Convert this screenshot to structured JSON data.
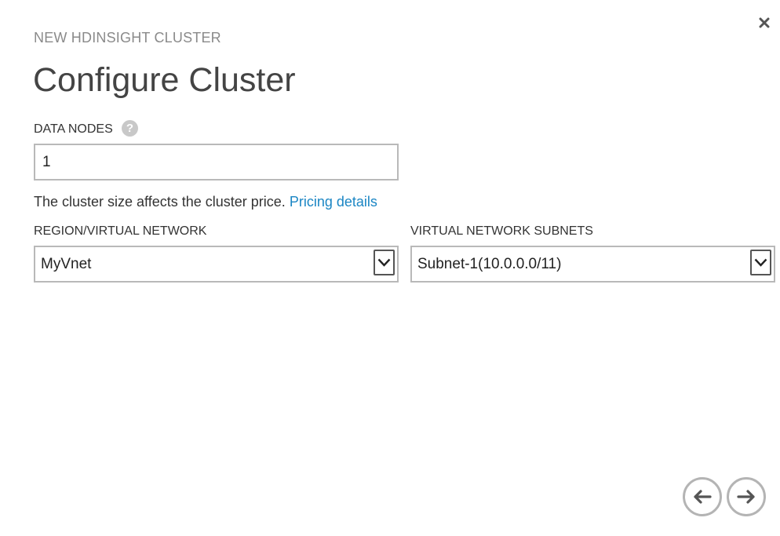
{
  "dialog": {
    "subtitle": "NEW HDINSIGHT CLUSTER",
    "title": "Configure Cluster",
    "close_icon": "close-icon"
  },
  "data_nodes": {
    "label": "DATA NODES",
    "help_icon": "help-icon",
    "help_glyph": "?",
    "value": "1"
  },
  "pricing": {
    "note": "The cluster size affects the cluster price.",
    "link_text": "Pricing details",
    "link_color": "#1b86c4"
  },
  "region": {
    "label": "REGION/VIRTUAL NETWORK",
    "selected": "MyVnet"
  },
  "subnets": {
    "label": "VIRTUAL NETWORK SUBNETS",
    "selected": "Subnet-1(10.0.0.0/11)"
  },
  "navigation": {
    "back_icon": "arrow-left-icon",
    "next_icon": "arrow-right-icon"
  }
}
